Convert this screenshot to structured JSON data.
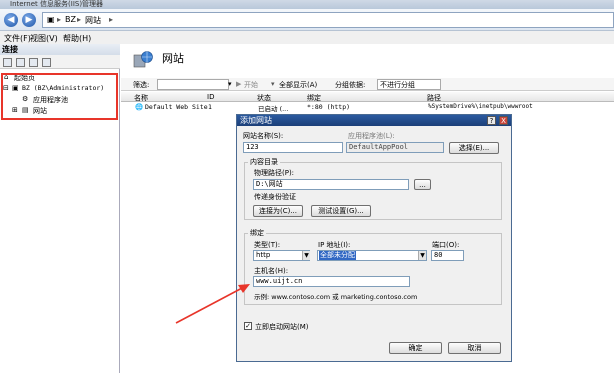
{
  "window": {
    "title": "Internet 信息服务(IIS)管理器"
  },
  "address": {
    "segments": [
      "BZ",
      "网站"
    ]
  },
  "menu": {
    "items": [
      "文件(F)",
      "视图(V)",
      "帮助(H)"
    ]
  },
  "connections": {
    "header": "连接",
    "tree": [
      {
        "label": "起始页"
      },
      {
        "label": "BZ (BZ\\Administrator)"
      },
      {
        "label": "应用程序池"
      },
      {
        "label": "网站"
      }
    ]
  },
  "sites": {
    "title": "网站",
    "filter": {
      "label": "筛选:",
      "go": "开始",
      "show_all": "全部显示(A)",
      "group_by": "分组依据:",
      "group_value": "不进行分组"
    },
    "columns": [
      "名称",
      "ID",
      "状态",
      "绑定",
      "路径"
    ],
    "rows": [
      {
        "name": "Default Web Site",
        "id": "1",
        "status": "已启动 (...",
        "binding": "*:80 (http)",
        "path": "%SystemDrive%\\inetpub\\wwwroot"
      }
    ]
  },
  "dialog": {
    "title": "添加网站",
    "help_button": "?",
    "close_button": "X",
    "site_name_label": "网站名称(S):",
    "site_name_value": "123",
    "app_pool_label": "应用程序池(L):",
    "app_pool_value": "DefaultAppPool",
    "select_button": "选择(E)...",
    "content_dir_label": "内容目录",
    "physical_path_label": "物理路径(P):",
    "physical_path_value": "D:\\网站",
    "browse_button": "...",
    "passthrough_label": "传递身份验证",
    "connect_as_button": "连接为(C)...",
    "test_settings_button": "测试设置(G)...",
    "binding_label": "绑定",
    "type_label": "类型(T):",
    "type_value": "http",
    "ip_label": "IP 地址(I):",
    "ip_value": "全部未分配",
    "port_label": "端口(O):",
    "port_value": "80",
    "host_label": "主机名(H):",
    "host_value": "www.uijt.cn",
    "example_text": "示例: www.contoso.com 或 marketing.contoso.com",
    "start_now_label": "立即启动网站(M)",
    "ok_button": "确定",
    "cancel_button": "取消"
  },
  "colors": {
    "annotation": "#e8352a",
    "dialog_title": "#1c3f78"
  }
}
